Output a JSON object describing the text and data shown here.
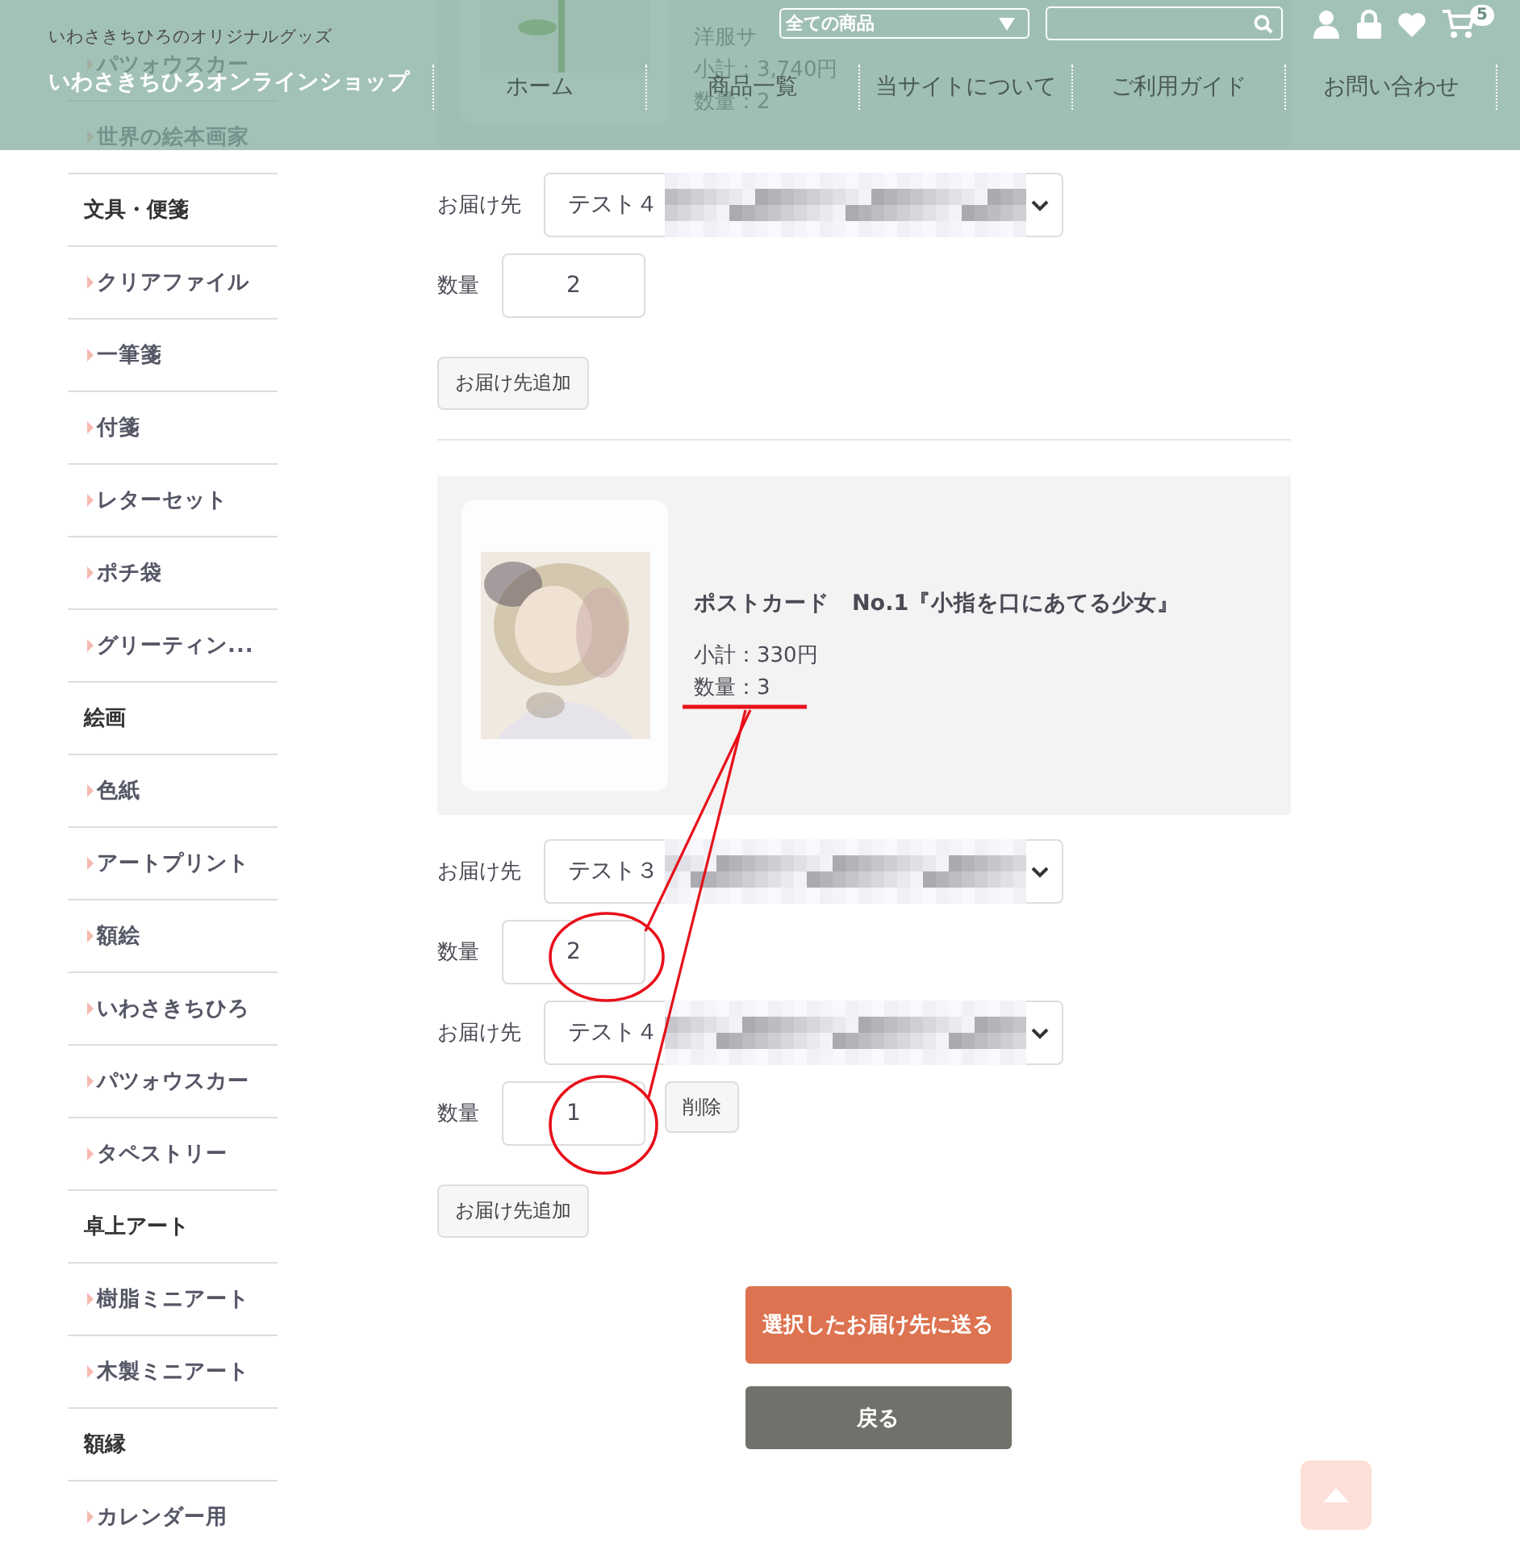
{
  "header": {
    "tagline": "いわさきちひろのオリジナルグッズ",
    "shop_name": "いわさきちひろオンラインショップ",
    "category_select": "全ての商品",
    "cart_count": "5",
    "nav": [
      "ホーム",
      "商品一覧",
      "当サイトについて",
      "ご利用ガイド",
      "お問い合わせ"
    ]
  },
  "sidebar": {
    "groups": [
      {
        "children": [
          "パツォウスカー",
          "世界の絵本画家"
        ]
      },
      {
        "label": "文具・便箋",
        "children": [
          "クリアファイル",
          "一筆箋",
          "付箋",
          "レターセット",
          "ポチ袋",
          "グリーティン..."
        ]
      },
      {
        "label": "絵画",
        "children": [
          "色紙",
          "アートプリント",
          "額絵",
          "いわさきちひろ",
          "パツォウスカー",
          "タペストリー"
        ]
      },
      {
        "label": "卓上アート",
        "children": [
          "樹脂ミニアート",
          "木製ミニアート"
        ]
      },
      {
        "label": "額縁",
        "children": [
          "カレンダー用"
        ]
      }
    ]
  },
  "items": [
    {
      "detail": "洋服サ",
      "subtotal": "小計：3,740円",
      "quantity": "数量：2",
      "destinations": [
        {
          "label": "お届け先",
          "address": "テスト４",
          "quantity_label": "数量",
          "quantity": "2"
        }
      ],
      "add_button": "お届け先追加"
    },
    {
      "title": "ポストカード　No.1『小指を口にあてる少女』",
      "subtotal": "小計：330円",
      "quantity": "数量：3",
      "destinations": [
        {
          "label": "お届け先",
          "address": "テスト３",
          "quantity_label": "数量",
          "quantity": "2"
        },
        {
          "label": "お届け先",
          "address": "テスト４",
          "quantity_label": "数量",
          "quantity": "1",
          "delete_button": "削除"
        }
      ],
      "add_button": "お届け先追加"
    }
  ],
  "submit_button": "選択したお届け先に送る",
  "back_button": "戻る"
}
